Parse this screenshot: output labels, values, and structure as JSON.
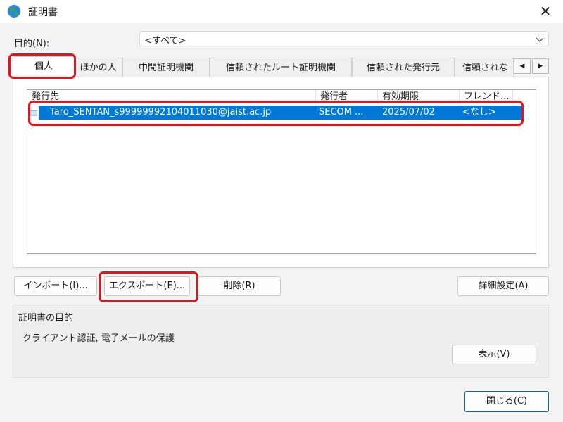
{
  "window": {
    "title": "証明書"
  },
  "purpose": {
    "label": "目的(N):",
    "value": "<すべて>"
  },
  "tabs": [
    {
      "label": "個人"
    },
    {
      "label": "ほかの人"
    },
    {
      "label": "中間証明機関"
    },
    {
      "label": "信頼されたルート証明機関"
    },
    {
      "label": "信頼された発行元"
    },
    {
      "label": "信頼されな"
    }
  ],
  "list": {
    "columns": [
      "発行先",
      "発行者",
      "有効期限",
      "フレンド..."
    ],
    "rows": [
      {
        "issued_to": "Taro_SENTAN_s99999992104011030@jaist.ac.jp",
        "issuer": "SECOM ...",
        "expiry": "2025/07/02",
        "friendly": "<なし>"
      }
    ]
  },
  "buttons": {
    "import": "インポート(I)...",
    "export": "エクスポート(E)...",
    "delete": "削除(R)",
    "advanced": "詳細設定(A)",
    "view": "表示(V)",
    "close": "閉じる(C)"
  },
  "purpose_group": {
    "title": "証明書の目的",
    "value": "クライアント認証, 電子メールの保護"
  },
  "colors": {
    "selection": "#0078d7",
    "annotation": "#e4131c"
  }
}
